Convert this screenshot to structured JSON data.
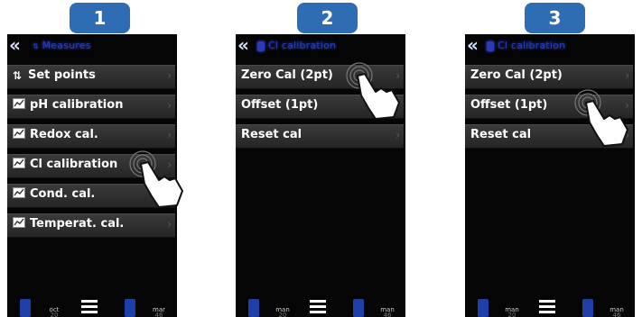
{
  "steps": [
    "1",
    "2",
    "3"
  ],
  "screen1": {
    "header_title": "Measures",
    "items": [
      {
        "icon": "setpoints-icon",
        "label": "Set points"
      },
      {
        "icon": "calibration-icon",
        "label": "pH calibration"
      },
      {
        "icon": "calibration-icon",
        "label": "Redox cal."
      },
      {
        "icon": "calibration-icon",
        "label": "Cl calibration"
      },
      {
        "icon": "calibration-icon",
        "label": "Cond. cal."
      },
      {
        "icon": "calibration-icon",
        "label": "Temperat. cal."
      }
    ],
    "footer": {
      "left_label": "oct",
      "left_value": "20",
      "right_label": "mar",
      "right_value": "46"
    }
  },
  "screen2": {
    "header_title": "Cl calibration",
    "items": [
      "Zero Cal (2pt)",
      "Offset (1pt)",
      "Reset cal"
    ],
    "footer": {
      "left_label": "man",
      "left_value": "20",
      "right_label": "man",
      "right_value": "46"
    }
  },
  "screen3": {
    "header_title": "Cl calibration",
    "items": [
      "Zero Cal (2pt)",
      "Offset (1pt)",
      "Reset cal"
    ],
    "footer": {
      "left_label": "man",
      "left_value": "20",
      "right_label": "man",
      "right_value": "46"
    }
  },
  "colors": {
    "step_badge": "#2e6db4",
    "screen_bg": "#050505",
    "row_bg": "#333333",
    "header_blue": "#2a3ab8"
  }
}
